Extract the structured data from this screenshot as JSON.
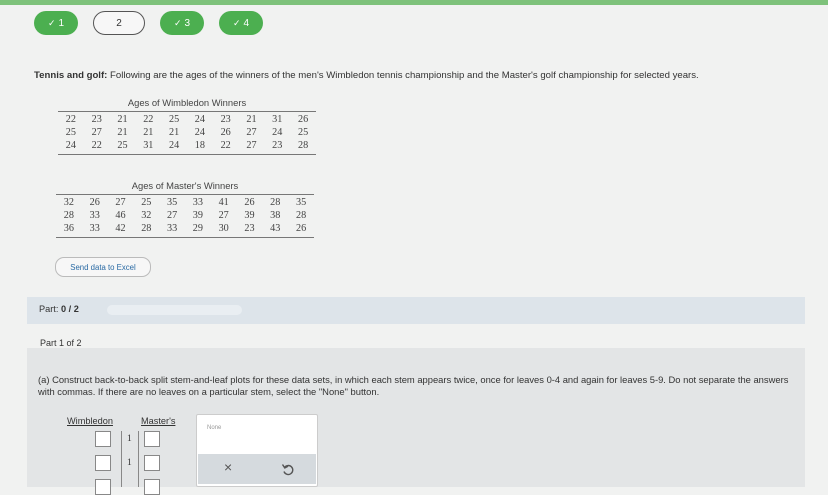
{
  "nav": {
    "questions": [
      {
        "label": "1",
        "status": "done"
      },
      {
        "label": "2",
        "status": "current"
      },
      {
        "label": "3",
        "status": "done"
      },
      {
        "label": "4",
        "status": "done"
      }
    ],
    "check_icon": "✓"
  },
  "prompt": {
    "title": "Tennis and golf:",
    "text": " Following are the ages of the winners of the men's Wimbledon tennis championship and the Master's golf championship for selected years."
  },
  "wimbledon": {
    "caption": "Ages of Wimbledon Winners",
    "rows": [
      [
        "22",
        "23",
        "21",
        "22",
        "25",
        "24",
        "23",
        "21",
        "31",
        "26"
      ],
      [
        "25",
        "27",
        "21",
        "21",
        "21",
        "24",
        "26",
        "27",
        "24",
        "25"
      ],
      [
        "24",
        "22",
        "25",
        "31",
        "24",
        "18",
        "22",
        "27",
        "23",
        "28"
      ]
    ]
  },
  "masters": {
    "caption": "Ages of Master's Winners",
    "rows": [
      [
        "32",
        "26",
        "27",
        "25",
        "35",
        "33",
        "41",
        "26",
        "28",
        "35"
      ],
      [
        "28",
        "33",
        "46",
        "32",
        "27",
        "39",
        "27",
        "39",
        "38",
        "28"
      ],
      [
        "36",
        "33",
        "42",
        "28",
        "33",
        "29",
        "30",
        "23",
        "43",
        "26"
      ]
    ]
  },
  "excel_button": "Send data to Excel",
  "part": {
    "label_prefix": "Part: ",
    "label_value": "0 / 2",
    "progress_fraction": 0
  },
  "part_header": "Part 1 of 2",
  "instruction": "(a) Construct back-to-back split stem-and-leaf plots for these data sets, in which each stem appears twice, once for leaves 0-4 and again for leaves 5-9. Do not separate the answers with commas. If there are no leaves on a particular stem, select the \"None\" button.",
  "plot": {
    "left_label": "Wimbledon",
    "right_label": "Master's",
    "stems": [
      "1",
      "1"
    ]
  },
  "tools": {
    "none_label": "None",
    "clear_icon": "×",
    "undo_icon": "undo-icon"
  }
}
